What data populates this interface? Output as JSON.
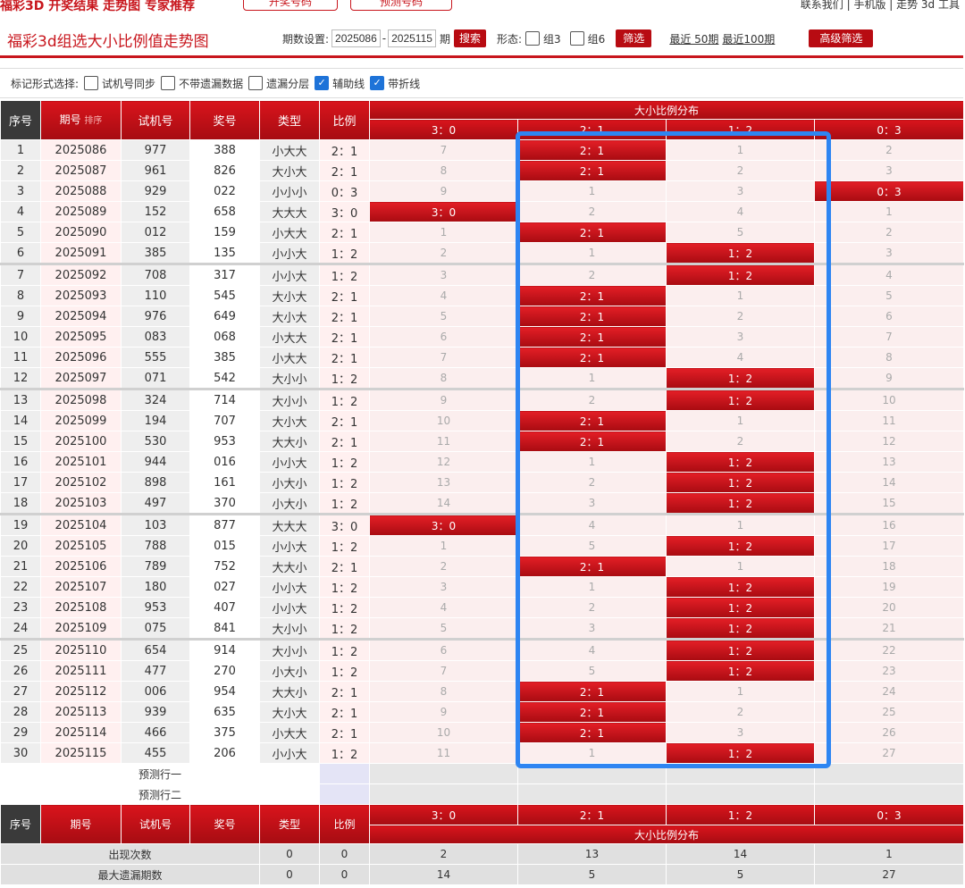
{
  "top": {
    "left_text": "福彩3D 开奖结果 走势图 专家推荐",
    "btn1": "开奖号码",
    "btn2": "预测号码",
    "right_text": "联系我们 | 手机版 | 走势 3d 工具"
  },
  "header": {
    "title": "福彩3d组选大小比例值走势图",
    "period_label": "期数设置:",
    "period_from": "2025086",
    "period_to": "2025115",
    "period_suffix": "期",
    "search_btn": "搜索",
    "shape_label": "形态:",
    "group3": "组3",
    "group6": "组6",
    "filter_btn": "筛选",
    "recent50": "最近 50期",
    "recent100": "最近100期",
    "advanced_btn": "高级筛选"
  },
  "options": {
    "label": "标记形式选择:",
    "items": [
      {
        "label": "试机号同步",
        "checked": false
      },
      {
        "label": "不带遗漏数据",
        "checked": false
      },
      {
        "label": "遗漏分层",
        "checked": false
      },
      {
        "label": "辅助线",
        "checked": true
      },
      {
        "label": "带折线",
        "checked": true
      }
    ]
  },
  "table": {
    "headers": {
      "seq": "序号",
      "period": "期号",
      "sort": "排序",
      "test": "试机号",
      "draw": "奖号",
      "type": "类型",
      "ratio": "比例",
      "dist": "大小比例分布"
    },
    "dist_cols": [
      "3：0",
      "2：1",
      "1：2",
      "0：3"
    ],
    "rows": [
      {
        "seq": "1",
        "period": "2025086",
        "test": "977",
        "draw": "388",
        "type": "小大大",
        "ratio": "2：1",
        "cells": [
          "7",
          "2：1",
          "1",
          "2"
        ],
        "hit": 1
      },
      {
        "seq": "2",
        "period": "2025087",
        "test": "961",
        "draw": "826",
        "type": "大小大",
        "ratio": "2：1",
        "cells": [
          "8",
          "2：1",
          "2",
          "3"
        ],
        "hit": 1
      },
      {
        "seq": "3",
        "period": "2025088",
        "test": "929",
        "draw": "022",
        "type": "小小小",
        "ratio": "0：3",
        "cells": [
          "9",
          "1",
          "3",
          "0：3"
        ],
        "hit": 3
      },
      {
        "seq": "4",
        "period": "2025089",
        "test": "152",
        "draw": "658",
        "type": "大大大",
        "ratio": "3：0",
        "cells": [
          "3：0",
          "2",
          "4",
          "1"
        ],
        "hit": 0
      },
      {
        "seq": "5",
        "period": "2025090",
        "test": "012",
        "draw": "159",
        "type": "小大大",
        "ratio": "2：1",
        "cells": [
          "1",
          "2：1",
          "5",
          "2"
        ],
        "hit": 1
      },
      {
        "seq": "6",
        "period": "2025091",
        "test": "385",
        "draw": "135",
        "type": "小小大",
        "ratio": "1：2",
        "cells": [
          "2",
          "1",
          "1：2",
          "3"
        ],
        "hit": 2
      },
      {
        "seq": "7",
        "period": "2025092",
        "test": "708",
        "draw": "317",
        "type": "小小大",
        "ratio": "1：2",
        "cells": [
          "3",
          "2",
          "1：2",
          "4"
        ],
        "hit": 2
      },
      {
        "seq": "8",
        "period": "2025093",
        "test": "110",
        "draw": "545",
        "type": "大小大",
        "ratio": "2：1",
        "cells": [
          "4",
          "2：1",
          "1",
          "5"
        ],
        "hit": 1
      },
      {
        "seq": "9",
        "period": "2025094",
        "test": "976",
        "draw": "649",
        "type": "大小大",
        "ratio": "2：1",
        "cells": [
          "5",
          "2：1",
          "2",
          "6"
        ],
        "hit": 1
      },
      {
        "seq": "10",
        "period": "2025095",
        "test": "083",
        "draw": "068",
        "type": "小大大",
        "ratio": "2：1",
        "cells": [
          "6",
          "2：1",
          "3",
          "7"
        ],
        "hit": 1
      },
      {
        "seq": "11",
        "period": "2025096",
        "test": "555",
        "draw": "385",
        "type": "小大大",
        "ratio": "2：1",
        "cells": [
          "7",
          "2：1",
          "4",
          "8"
        ],
        "hit": 1
      },
      {
        "seq": "12",
        "period": "2025097",
        "test": "071",
        "draw": "542",
        "type": "大小小",
        "ratio": "1：2",
        "cells": [
          "8",
          "1",
          "1：2",
          "9"
        ],
        "hit": 2
      },
      {
        "seq": "13",
        "period": "2025098",
        "test": "324",
        "draw": "714",
        "type": "大小小",
        "ratio": "1：2",
        "cells": [
          "9",
          "2",
          "1：2",
          "10"
        ],
        "hit": 2
      },
      {
        "seq": "14",
        "period": "2025099",
        "test": "194",
        "draw": "707",
        "type": "大小大",
        "ratio": "2：1",
        "cells": [
          "10",
          "2：1",
          "1",
          "11"
        ],
        "hit": 1
      },
      {
        "seq": "15",
        "period": "2025100",
        "test": "530",
        "draw": "953",
        "type": "大大小",
        "ratio": "2：1",
        "cells": [
          "11",
          "2：1",
          "2",
          "12"
        ],
        "hit": 1
      },
      {
        "seq": "16",
        "period": "2025101",
        "test": "944",
        "draw": "016",
        "type": "小小大",
        "ratio": "1：2",
        "cells": [
          "12",
          "1",
          "1：2",
          "13"
        ],
        "hit": 2
      },
      {
        "seq": "17",
        "period": "2025102",
        "test": "898",
        "draw": "161",
        "type": "小大小",
        "ratio": "1：2",
        "cells": [
          "13",
          "2",
          "1：2",
          "14"
        ],
        "hit": 2
      },
      {
        "seq": "18",
        "period": "2025103",
        "test": "497",
        "draw": "370",
        "type": "小大小",
        "ratio": "1：2",
        "cells": [
          "14",
          "3",
          "1：2",
          "15"
        ],
        "hit": 2
      },
      {
        "seq": "19",
        "period": "2025104",
        "test": "103",
        "draw": "877",
        "type": "大大大",
        "ratio": "3：0",
        "cells": [
          "3：0",
          "4",
          "1",
          "16"
        ],
        "hit": 0
      },
      {
        "seq": "20",
        "period": "2025105",
        "test": "788",
        "draw": "015",
        "type": "小小大",
        "ratio": "1：2",
        "cells": [
          "1",
          "5",
          "1：2",
          "17"
        ],
        "hit": 2
      },
      {
        "seq": "21",
        "period": "2025106",
        "test": "789",
        "draw": "752",
        "type": "大大小",
        "ratio": "2：1",
        "cells": [
          "2",
          "2：1",
          "1",
          "18"
        ],
        "hit": 1
      },
      {
        "seq": "22",
        "period": "2025107",
        "test": "180",
        "draw": "027",
        "type": "小小大",
        "ratio": "1：2",
        "cells": [
          "3",
          "1",
          "1：2",
          "19"
        ],
        "hit": 2
      },
      {
        "seq": "23",
        "period": "2025108",
        "test": "953",
        "draw": "407",
        "type": "小小大",
        "ratio": "1：2",
        "cells": [
          "4",
          "2",
          "1：2",
          "20"
        ],
        "hit": 2
      },
      {
        "seq": "24",
        "period": "2025109",
        "test": "075",
        "draw": "841",
        "type": "大小小",
        "ratio": "1：2",
        "cells": [
          "5",
          "3",
          "1：2",
          "21"
        ],
        "hit": 2
      },
      {
        "seq": "25",
        "period": "2025110",
        "test": "654",
        "draw": "914",
        "type": "大小小",
        "ratio": "1：2",
        "cells": [
          "6",
          "4",
          "1：2",
          "22"
        ],
        "hit": 2
      },
      {
        "seq": "26",
        "period": "2025111",
        "test": "477",
        "draw": "270",
        "type": "小大小",
        "ratio": "1：2",
        "cells": [
          "7",
          "5",
          "1：2",
          "23"
        ],
        "hit": 2
      },
      {
        "seq": "27",
        "period": "2025112",
        "test": "006",
        "draw": "954",
        "type": "大大小",
        "ratio": "2：1",
        "cells": [
          "8",
          "2：1",
          "1",
          "24"
        ],
        "hit": 1
      },
      {
        "seq": "28",
        "period": "2025113",
        "test": "939",
        "draw": "635",
        "type": "大小大",
        "ratio": "2：1",
        "cells": [
          "9",
          "2：1",
          "2",
          "25"
        ],
        "hit": 1
      },
      {
        "seq": "29",
        "period": "2025114",
        "test": "466",
        "draw": "375",
        "type": "小大大",
        "ratio": "2：1",
        "cells": [
          "10",
          "2：1",
          "3",
          "26"
        ],
        "hit": 1
      },
      {
        "seq": "30",
        "period": "2025115",
        "test": "455",
        "draw": "206",
        "type": "小小大",
        "ratio": "1：2",
        "cells": [
          "11",
          "1",
          "1：2",
          "27"
        ],
        "hit": 2
      }
    ],
    "predict": [
      "预测行一",
      "预测行二"
    ],
    "footer": {
      "seq": "序号",
      "period": "期号",
      "test": "试机号",
      "draw": "奖号",
      "type": "类型",
      "ratio": "比例",
      "dist": "大小比例分布"
    },
    "stats": [
      {
        "label": "出现次数",
        "type": "0",
        "ratio": "0",
        "cells": [
          "2",
          "13",
          "14",
          "1"
        ]
      },
      {
        "label": "最大遗漏期数",
        "type": "0",
        "ratio": "0",
        "cells": [
          "14",
          "5",
          "5",
          "27"
        ]
      }
    ]
  },
  "colors": {
    "accent": "#c8161d",
    "highlight": "#2e85f2"
  }
}
